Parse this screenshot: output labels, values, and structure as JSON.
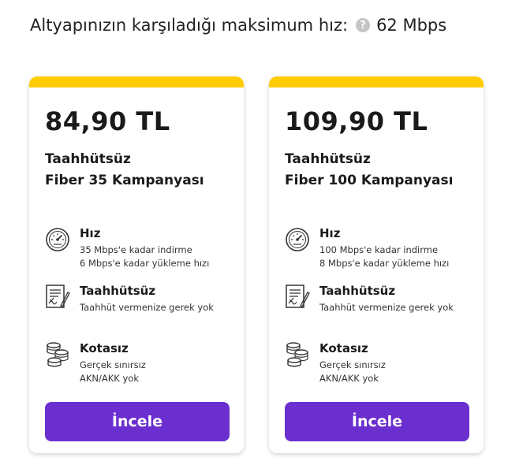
{
  "headline": {
    "text": "Altyapınızın karşıladığı maksimum hız:",
    "help_glyph": "?",
    "speed": "62 Mbps"
  },
  "cards": [
    {
      "price": "84,90 TL",
      "title_line1": "Taahhütsüz",
      "title_line2": "Fiber 35 Kampanyası",
      "features": {
        "speed": {
          "title": "Hız",
          "line1": "35 Mbps'e kadar indirme",
          "line2": "6 Mbps'e kadar yükleme hızı"
        },
        "commit": {
          "title": "Taahhütsüz",
          "line1": "Taahhüt vermenize gerek yok"
        },
        "quota": {
          "title": "Kotasız",
          "line1": "Gerçek sınırsız",
          "line2": "AKN/AKK yok"
        }
      },
      "button": "İncele"
    },
    {
      "price": "109,90 TL",
      "title_line1": "Taahhütsüz",
      "title_line2": "Fiber 100 Kampanyası",
      "features": {
        "speed": {
          "title": "Hız",
          "line1": "100 Mbps'e kadar indirme",
          "line2": "8 Mbps'e kadar yükleme hızı"
        },
        "commit": {
          "title": "Taahhütsüz",
          "line1": "Taahhüt vermenize gerek yok"
        },
        "quota": {
          "title": "Kotasız",
          "line1": "Gerçek sınırsız",
          "line2": "AKN/AKK yok"
        }
      },
      "button": "İncele"
    }
  ],
  "colors": {
    "accent_bar": "#ffcc00",
    "button": "#6b2fd0"
  },
  "icons": [
    "speedometer-icon",
    "contract-icon",
    "coins-stack-icon",
    "help-icon"
  ]
}
